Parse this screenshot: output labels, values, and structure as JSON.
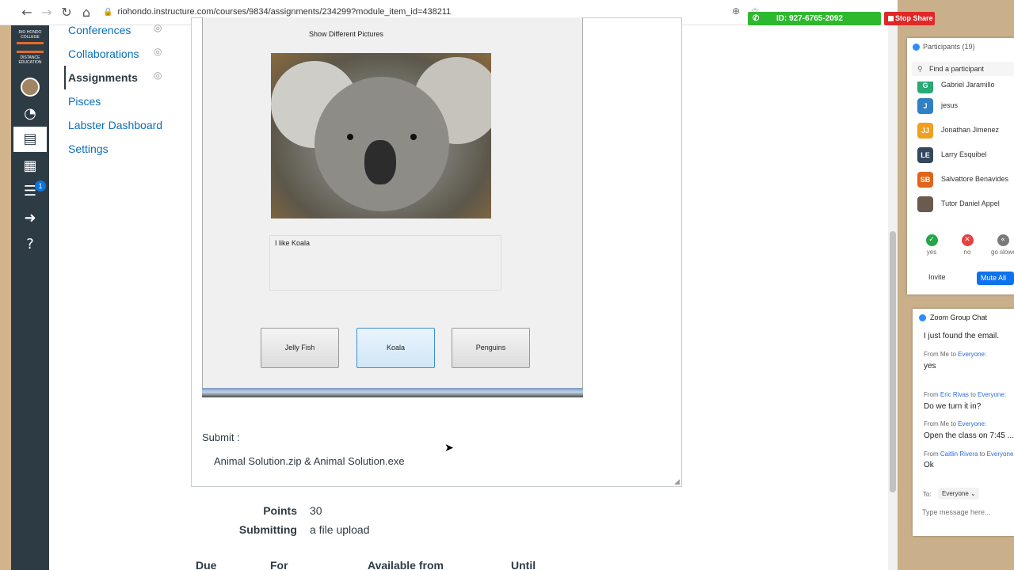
{
  "browser": {
    "url": "riohondo.instructure.com/courses/9834/assignments/234299?module_item_id=438211"
  },
  "zoom_bar": {
    "meeting_id": "ID: 927-6765-2092",
    "stop_share": "Stop Share"
  },
  "logo": {
    "line1": "RIO HONDO COLLEGE",
    "line2": "DISTANCE EDUCATION"
  },
  "global_nav": {
    "inbox_badge": "1"
  },
  "course_nav": {
    "items": [
      {
        "label": "Conferences",
        "hidden": true
      },
      {
        "label": "Collaborations",
        "hidden": true
      },
      {
        "label": "Assignments",
        "hidden": true
      },
      {
        "label": "Pisces",
        "hidden": false
      },
      {
        "label": "Labster Dashboard",
        "hidden": false
      },
      {
        "label": "Settings",
        "hidden": false
      }
    ]
  },
  "form_screenshot": {
    "title": "Show Different Pictures",
    "textbox": "I like Koala",
    "buttons": [
      "Jelly Fish",
      "Koala",
      "Penguins"
    ]
  },
  "submit": {
    "label": "Submit :",
    "files": "Animal  Solution.zip & Animal Solution.exe"
  },
  "details": {
    "points_label": "Points",
    "points_value": "30",
    "submitting_label": "Submitting",
    "submitting_value": "a file upload"
  },
  "due_table": {
    "headers": [
      "Due",
      "For",
      "Available from",
      "Until"
    ]
  },
  "participants": {
    "title": "Participants (19)",
    "search_placeholder": "Find a participant",
    "list": [
      {
        "initials": "G",
        "name": "Gabriel Jaramillo",
        "color": "#2aa876"
      },
      {
        "initials": "J",
        "name": "jesus",
        "color": "#2f80c4"
      },
      {
        "initials": "JJ",
        "name": "Jonathan Jimenez",
        "color": "#f0a020"
      },
      {
        "initials": "LE",
        "name": "Larry Esquibel",
        "color": "#34495e"
      },
      {
        "initials": "SB",
        "name": "Salvattore Benavides",
        "color": "#e0651c"
      },
      {
        "initials": "",
        "name": "Tutor Daniel Appel",
        "color": "#6b5a4e"
      }
    ],
    "reactions": [
      {
        "label": "yes",
        "color": "#23a648"
      },
      {
        "label": "no",
        "color": "#e84040"
      },
      {
        "label": "go slower",
        "color": "#7a7a7a"
      }
    ],
    "invite": "Invite",
    "mute_all": "Mute All"
  },
  "chat": {
    "title": "Zoom Group Chat",
    "messages": [
      {
        "from": "",
        "to": "",
        "text": "I just found the email."
      },
      {
        "from": "Me",
        "to": "Everyone",
        "text": "yes"
      },
      {
        "from": "Eric Rivas",
        "to": "Everyone",
        "text": "Do we turn it in?"
      },
      {
        "from": "Me",
        "to": "Everyone",
        "text": "Open the class on  7:45 ..."
      },
      {
        "from": "Caitlin Rivera",
        "to": "Everyone",
        "text": "Ok"
      }
    ],
    "to_label": "To:",
    "to_value": "Everyone",
    "input_placeholder": "Type message here..."
  }
}
